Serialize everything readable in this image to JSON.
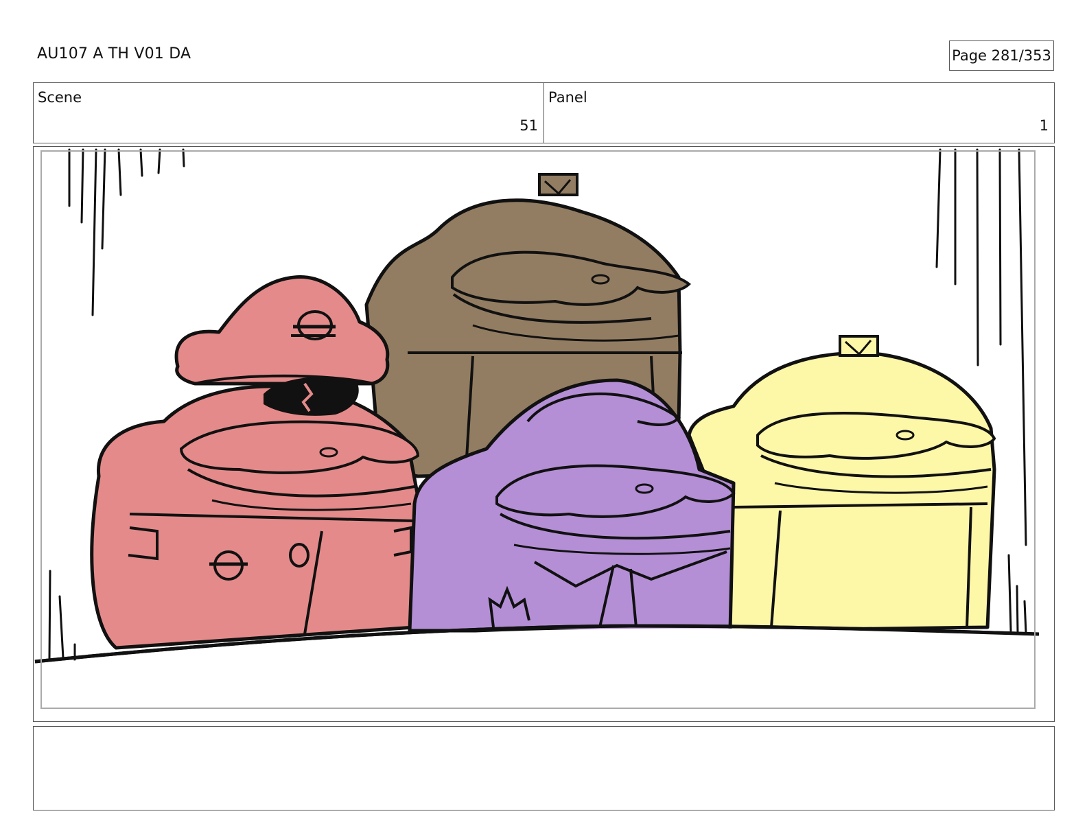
{
  "header": {
    "doc_title": "AU107 A TH V01 DA",
    "page_label": "Page 281/353"
  },
  "info": {
    "scene_label": "Scene",
    "scene_value": "51",
    "panel_label": "Panel",
    "panel_value": "1"
  },
  "artwork": {
    "characters": [
      {
        "name": "pink-capped-blob",
        "color": "#e58a8a"
      },
      {
        "name": "brown-blob",
        "color": "#937d62"
      },
      {
        "name": "purple-blob",
        "color": "#b48fd6"
      },
      {
        "name": "yellow-blob",
        "color": "#fdf7a8"
      }
    ],
    "line_color": "#111111"
  },
  "notes": {
    "text": ""
  }
}
